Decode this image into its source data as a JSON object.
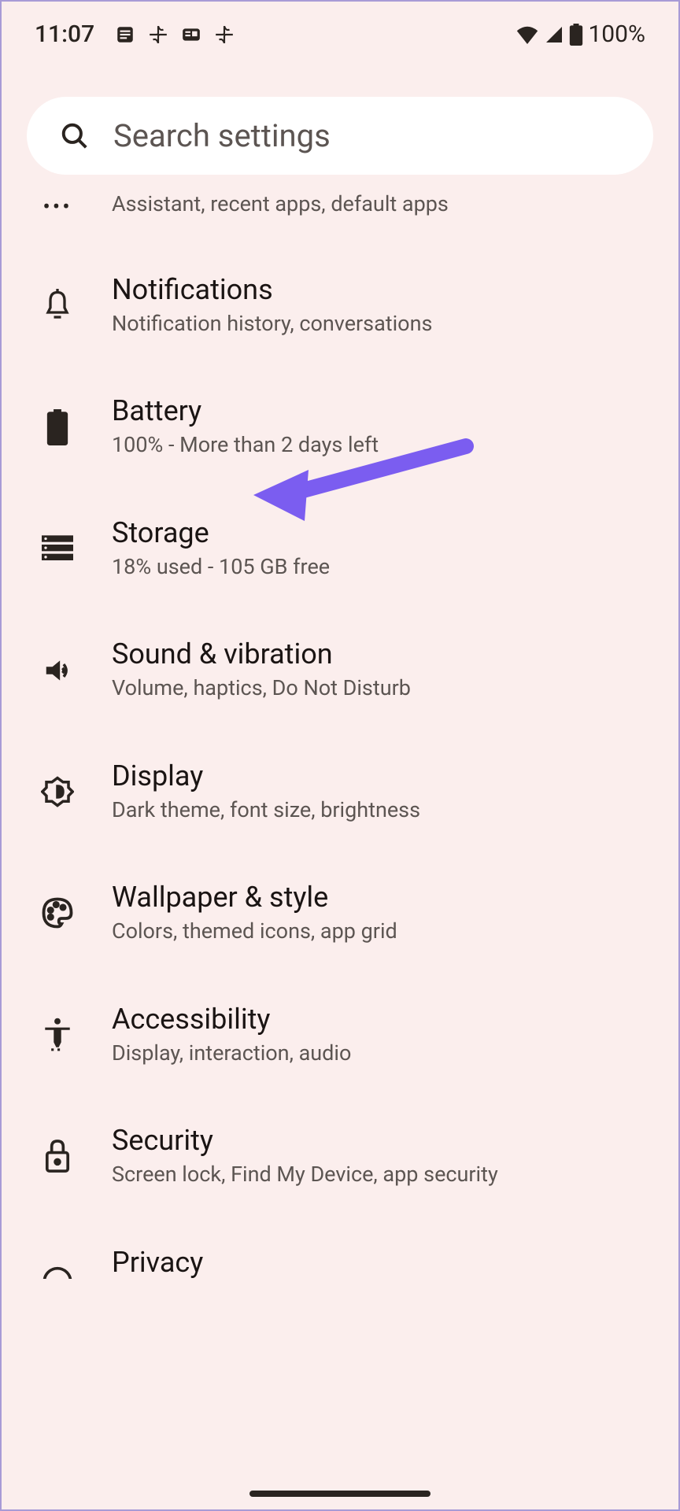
{
  "status": {
    "time": "11:07",
    "battery": "100%"
  },
  "search": {
    "placeholder": "Search settings"
  },
  "partial": {
    "subtitle": "Assistant, recent apps, default apps"
  },
  "items": [
    {
      "title": "Notifications",
      "subtitle": "Notification history, conversations"
    },
    {
      "title": "Battery",
      "subtitle": "100% - More than 2 days left"
    },
    {
      "title": "Storage",
      "subtitle": "18% used - 105 GB free"
    },
    {
      "title": "Sound & vibration",
      "subtitle": "Volume, haptics, Do Not Disturb"
    },
    {
      "title": "Display",
      "subtitle": "Dark theme, font size, brightness"
    },
    {
      "title": "Wallpaper & style",
      "subtitle": "Colors, themed icons, app grid"
    },
    {
      "title": "Accessibility",
      "subtitle": "Display, interaction, audio"
    },
    {
      "title": "Security",
      "subtitle": "Screen lock, Find My Device, app security"
    },
    {
      "title": "Privacy",
      "subtitle": ""
    }
  ],
  "annotation": {
    "arrow_color": "#7b5df0"
  }
}
